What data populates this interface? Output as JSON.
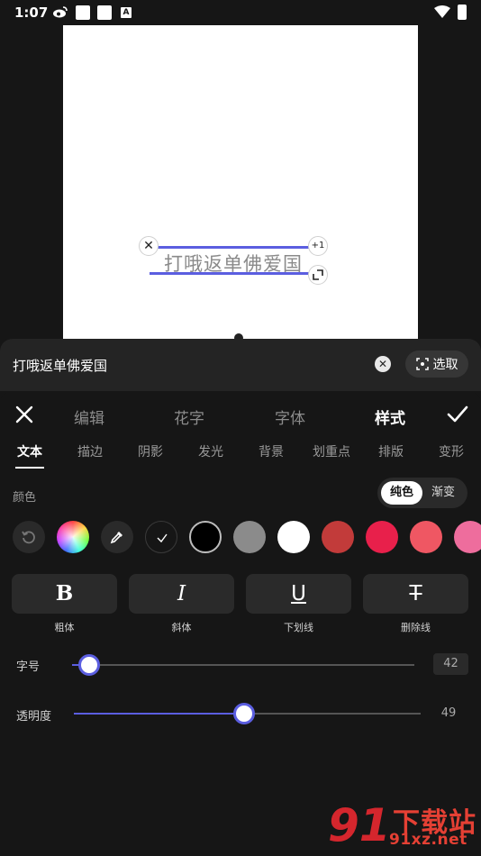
{
  "status_bar": {
    "time": "1:07",
    "badge": "A"
  },
  "canvas": {
    "text": "打哦返单佛爱国",
    "plus_badge": "+1"
  },
  "input_row": {
    "text": "打哦返单佛爱国",
    "select_label": "选取"
  },
  "top_tabs": [
    {
      "label": "编辑"
    },
    {
      "label": "花字"
    },
    {
      "label": "字体"
    },
    {
      "label": "样式"
    }
  ],
  "active_top_tab": "样式",
  "sub_tabs": [
    {
      "label": "文本"
    },
    {
      "label": "描边"
    },
    {
      "label": "阴影"
    },
    {
      "label": "发光"
    },
    {
      "label": "背景"
    },
    {
      "label": "划重点"
    },
    {
      "label": "排版"
    },
    {
      "label": "变形"
    }
  ],
  "active_sub_tab": "文本",
  "color_section": {
    "label": "颜色",
    "mode_options": [
      "纯色",
      "渐变"
    ],
    "selected_mode": "纯色",
    "swatches": [
      "#000000",
      "#8b8b8b",
      "#ffffff",
      "#c23b3a",
      "#e8204b",
      "#ef5763",
      "#ee6d9d"
    ],
    "selected_swatch": "#000000"
  },
  "format_buttons": [
    {
      "glyph": "B",
      "label": "粗体"
    },
    {
      "glyph": "I",
      "label": "斜体"
    },
    {
      "glyph": "U",
      "label": "下划线"
    },
    {
      "glyph": "T",
      "label": "删除线"
    }
  ],
  "font_size": {
    "label": "字号",
    "value": "42",
    "fraction": 0.05
  },
  "opacity": {
    "label": "透明度",
    "value": "49",
    "fraction": 0.49
  },
  "accent_color": "#5b5ee0",
  "watermark": {
    "title": "下载站",
    "url": "91xz.net",
    "logo_text": "91"
  }
}
